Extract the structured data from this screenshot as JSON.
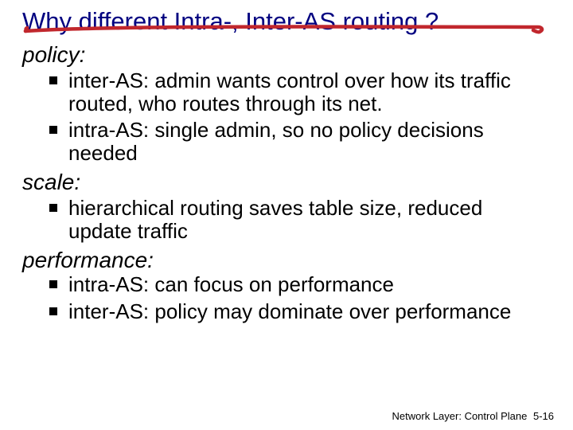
{
  "title": "Why different Intra-, Inter-AS routing ?",
  "sections": {
    "policy": {
      "heading": "policy:",
      "items": [
        "inter-AS: admin wants control over how its traffic routed, who routes through its net.",
        "intra-AS: single admin, so no policy decisions needed"
      ]
    },
    "scale": {
      "heading": "scale:",
      "items": [
        "hierarchical routing saves table size, reduced update traffic"
      ]
    },
    "performance": {
      "heading": "performance:",
      "items": [
        "intra-AS: can focus on performance",
        "inter-AS: policy may dominate over performance"
      ]
    }
  },
  "footer": {
    "chapter": "Network Layer: Control Plane",
    "page": "5-16"
  },
  "annotation": {
    "stroke": "#C1272D"
  }
}
